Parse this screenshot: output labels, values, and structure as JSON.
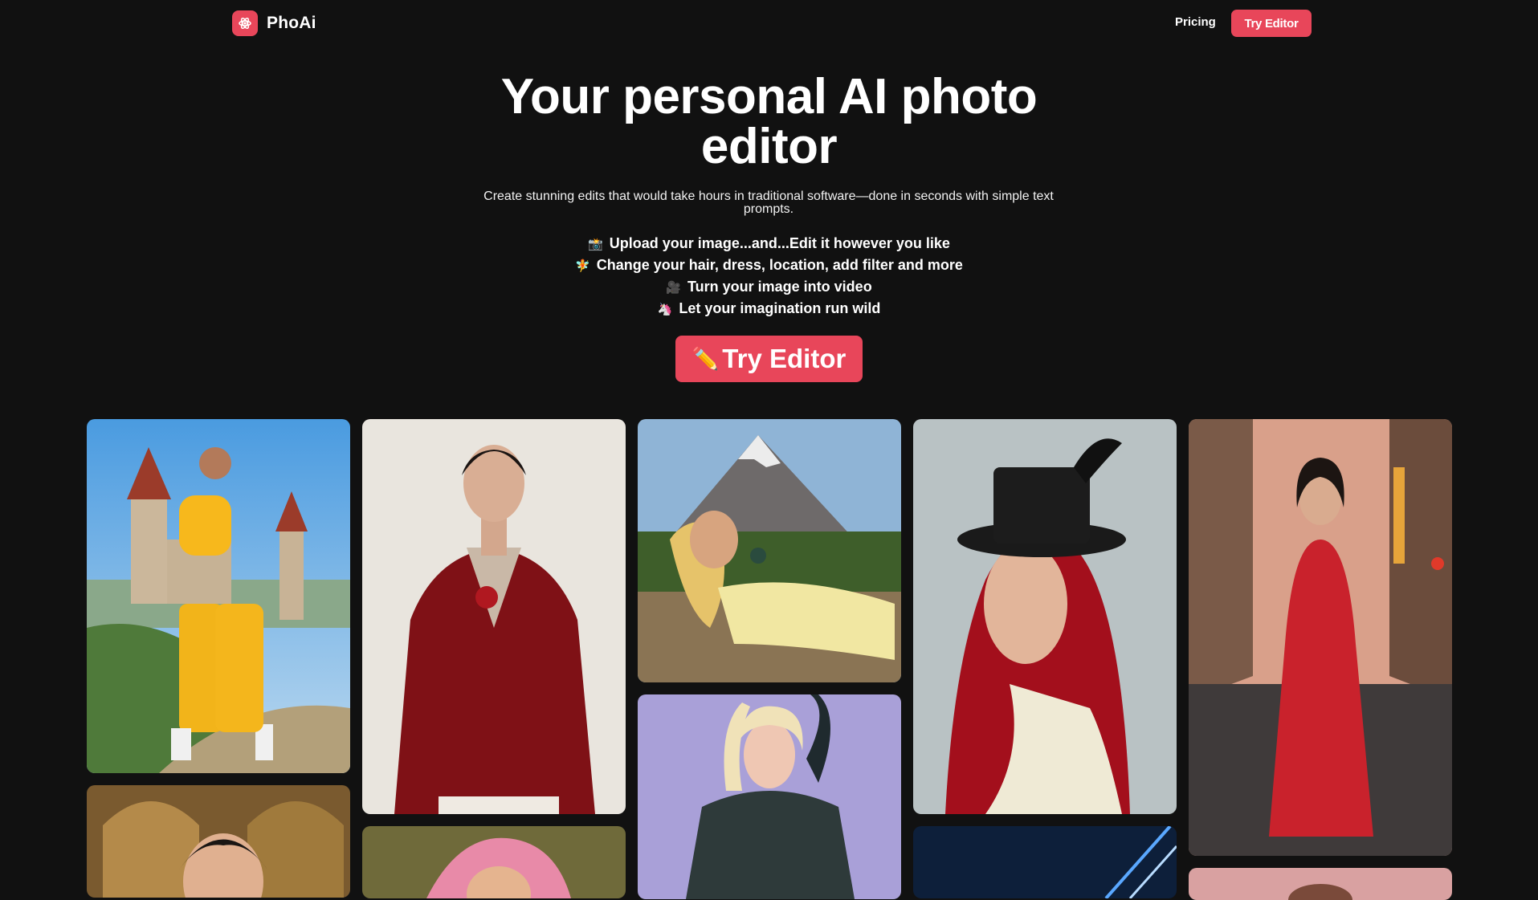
{
  "brand": {
    "name": "PhoAi",
    "accent": "#e8465a",
    "logo_icon": "atom-flower-icon"
  },
  "nav": {
    "pricing": "Pricing",
    "try_editor": "Try Editor"
  },
  "hero": {
    "title_line1": "Your personal AI photo",
    "title_line2": "editor",
    "subtitle": "Create stunning edits that would take hours in traditional software—done in seconds with simple text prompts.",
    "features": [
      {
        "icon": "📸",
        "text": "Upload your image...and...Edit it however you like"
      },
      {
        "icon": "🧚",
        "text": "Change your hair, dress, location, add filter and more"
      },
      {
        "icon": "🎥",
        "text": "Turn your image into video"
      },
      {
        "icon": "🦄",
        "text": "Let your imagination run wild"
      }
    ],
    "cta_icon": "✏️",
    "cta_label": "Try Editor"
  },
  "gallery": [
    {
      "subject": "woman in yellow tracksuit in front of castle"
    },
    {
      "subject": "woman in red velvet blazer"
    },
    {
      "subject": "blonde woman lying in front of a mountain"
    },
    {
      "subject": "red-haired woman wearing black top hat"
    },
    {
      "subject": "woman in red floral dress on street"
    },
    {
      "subject": "man with dark hair in ornate hall"
    },
    {
      "subject": "woman with pink hair"
    },
    {
      "subject": "blonde woman in metallic outfit"
    },
    {
      "subject": "blue neon scene"
    },
    {
      "subject": "partial image"
    }
  ]
}
